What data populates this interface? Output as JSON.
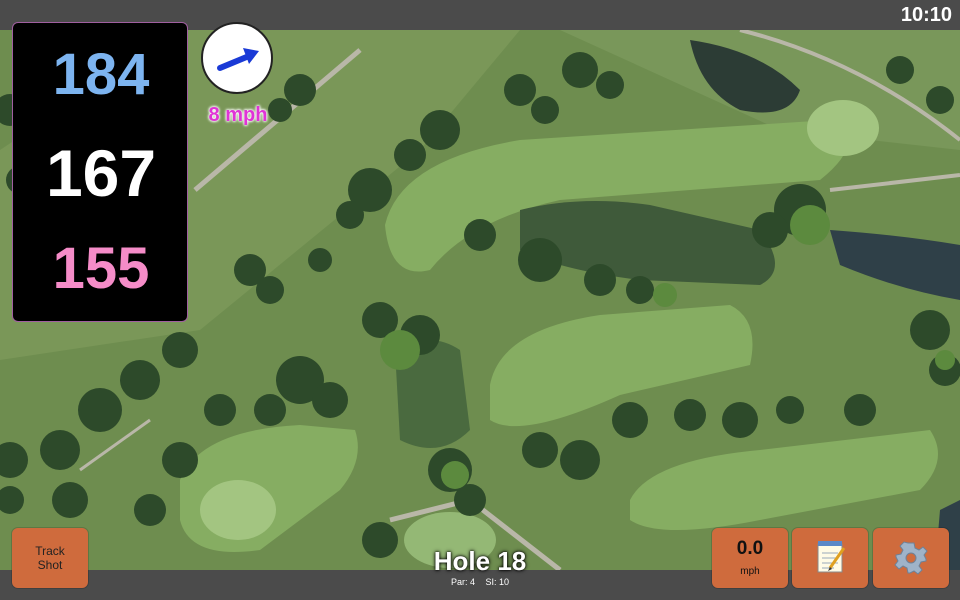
{
  "status": {
    "time": "10:10"
  },
  "distances": {
    "back": "184",
    "middle": "167",
    "front": "155",
    "colors": {
      "back": "#7db4f0",
      "middle": "#ffffff",
      "front": "#f58cc8"
    }
  },
  "wind": {
    "speed": "8 mph",
    "arrow_icon": "wind-arrow-icon"
  },
  "buttons": {
    "track_shot": "Track\nShot",
    "speed_value": "0.0",
    "speed_unit": "mph",
    "notes_icon": "notepad-icon",
    "settings_icon": "gear-icon"
  },
  "hole": {
    "title": "Hole 18",
    "par": "Par: 4",
    "si": "SI: 10"
  },
  "colors": {
    "button": "#cf6b3d",
    "accent": "#e033d6"
  }
}
